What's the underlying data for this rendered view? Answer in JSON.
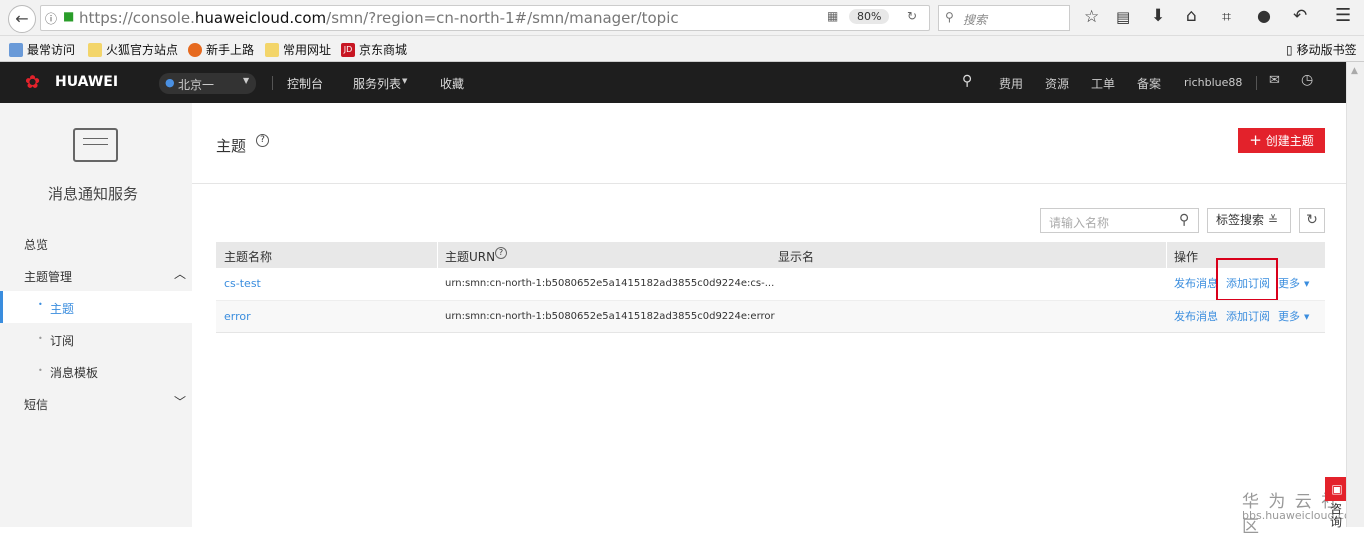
{
  "browser": {
    "url_prefix": "https://console.",
    "url_domain": "huaweicloud.com",
    "url_suffix": "/smn/?region=cn-north-1#/smn/manager/topic",
    "zoom": "80%",
    "search_placeholder": "搜索",
    "mobile_bookmarks": "移动版书签",
    "bookmarks": [
      "最常访问",
      "火狐官方站点",
      "新手上路",
      "常用网址",
      "京东商城"
    ]
  },
  "nav": {
    "logo": "HUAWEI",
    "region": "北京一",
    "console": "控制台",
    "services": "服务列表",
    "favorites": "收藏",
    "right": [
      "费用",
      "资源",
      "工单",
      "备案"
    ],
    "user": "richblue88"
  },
  "sidebar": {
    "service_title": "消息通知服务",
    "items": [
      "总览",
      "主题管理",
      "主题",
      "订阅",
      "消息模板",
      "短信"
    ]
  },
  "main": {
    "title": "主题",
    "create_button": "创建主题",
    "search_placeholder": "请输入名称",
    "tag_search": "标签搜索",
    "columns": [
      "主题名称",
      "主题URN",
      "显示名",
      "操作"
    ],
    "rows": [
      {
        "name": "cs-test",
        "urn": "urn:smn:cn-north-1:b5080652e5a1415182ad3855c0d9224e:cs-...",
        "display": "",
        "actions": [
          "发布消息",
          "添加订阅",
          "更多"
        ]
      },
      {
        "name": "error",
        "urn": "urn:smn:cn-north-1:b5080652e5a1415182ad3855c0d9224e:error",
        "display": "",
        "actions": [
          "发布消息",
          "添加订阅",
          "更多"
        ]
      }
    ]
  },
  "watermark": {
    "title": "华 为 云 社 区",
    "url": "bbs.huaweicloud.com"
  },
  "consult": "咨询",
  "colors": {
    "accent": "#e3222b",
    "link": "#3a8dde",
    "nav": "#1e1e1e"
  }
}
